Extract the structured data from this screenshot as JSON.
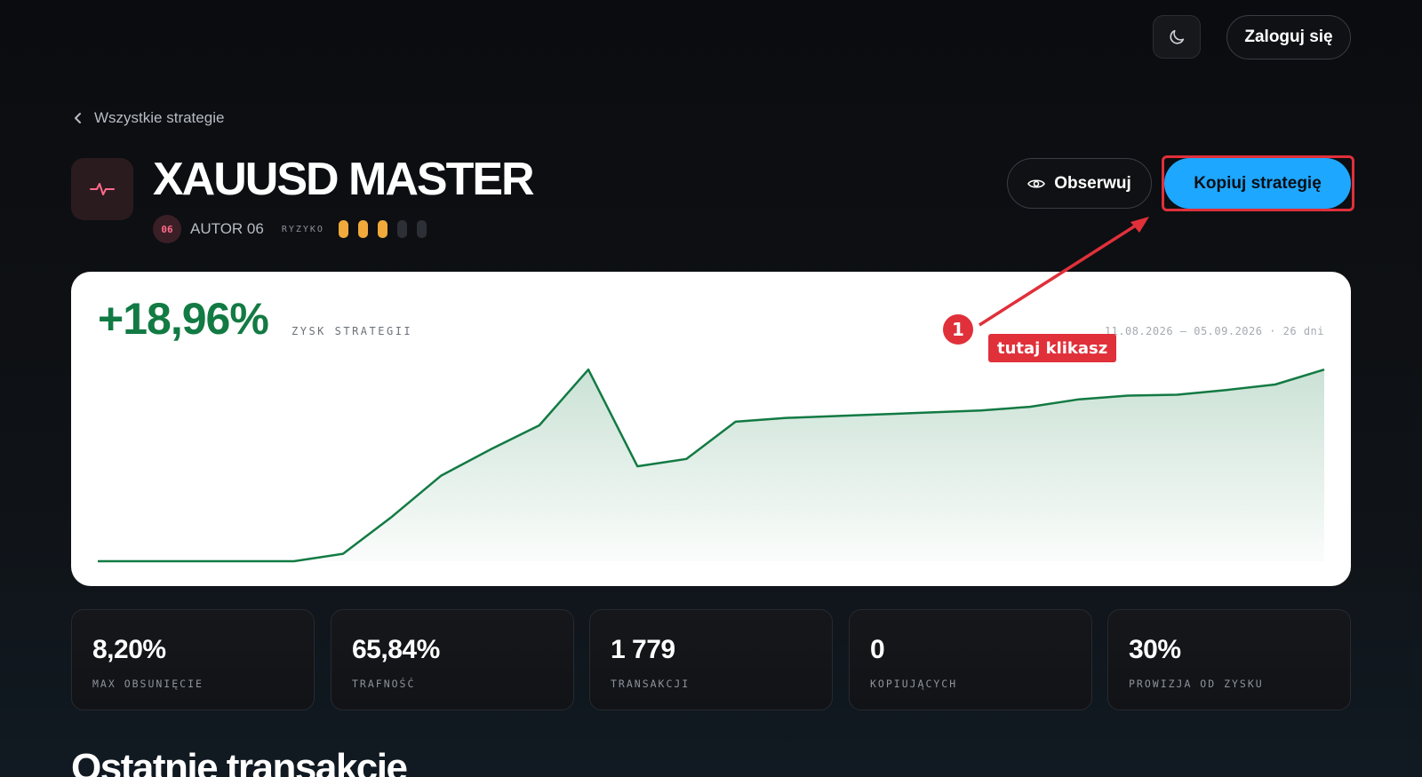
{
  "header": {
    "theme_icon": "moon-icon",
    "login_label": "Zaloguj się"
  },
  "breadcrumb": {
    "icon": "chevron-left-icon",
    "label": "Wszystkie strategie"
  },
  "strategy": {
    "icon": "pulse-icon",
    "title": "XAUUSD MASTER",
    "author_badge": "06",
    "author": "AUTOR 06",
    "risk_label": "RYZYKO",
    "risk_level": 3,
    "risk_max": 5,
    "risk_color": "#f0a93b",
    "watch_label": "Obserwuj",
    "watch_icon": "eye-icon",
    "copy_label": "Kopiuj strategię",
    "accent": "#1ea7ff"
  },
  "chart": {
    "profit": "+18,96%",
    "profit_label": "ZYSK STRATEGII",
    "date_range": "11.08.2026 – 05.09.2026 · 26 dni",
    "line_color": "#127a43"
  },
  "chart_data": {
    "type": "area",
    "title": "",
    "xlabel": "",
    "ylabel": "",
    "x": [
      1,
      2,
      3,
      4,
      5,
      6,
      7,
      8,
      9,
      10,
      11,
      12,
      13,
      14,
      15,
      16,
      17,
      18,
      19,
      20,
      21,
      22,
      23,
      24,
      25,
      26
    ],
    "values": [
      0,
      0,
      0,
      0,
      0,
      0.4,
      2.4,
      4.6,
      6.0,
      7.3,
      10.3,
      5.1,
      5.5,
      7.5,
      7.7,
      7.8,
      7.9,
      8.0,
      8.1,
      8.3,
      8.7,
      8.9,
      8.95,
      9.2,
      9.5,
      10.3
    ],
    "ylim": [
      0,
      10.5
    ],
    "grid": false,
    "legend": "none"
  },
  "annotation": {
    "number": "1",
    "label": "tutaj klikasz",
    "color": "#e0303a"
  },
  "stats": [
    {
      "value": "8,20%",
      "label": "MAX OBSUNIĘCIE"
    },
    {
      "value": "65,84%",
      "label": "TRAFNOŚĆ"
    },
    {
      "value": "1 779",
      "label": "TRANSAKCJI"
    },
    {
      "value": "0",
      "label": "KOPIUJĄCYCH"
    },
    {
      "value": "30%",
      "label": "PROWIZJA OD ZYSKU"
    }
  ],
  "recent": {
    "title": "Ostatnie transakcje"
  }
}
